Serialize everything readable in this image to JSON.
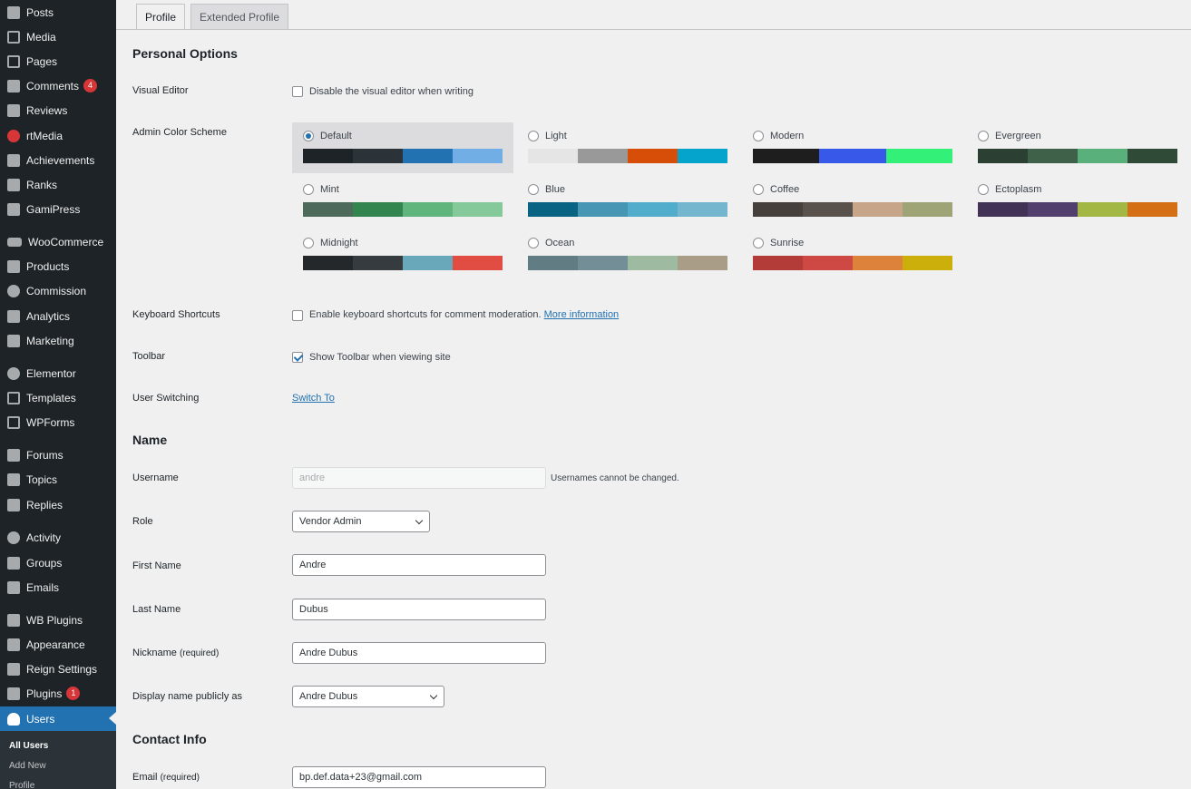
{
  "sidebar": {
    "items": [
      {
        "label": "Posts",
        "icon": "pin-icon"
      },
      {
        "label": "Media",
        "icon": "media-icon"
      },
      {
        "label": "Pages",
        "icon": "pages-icon"
      },
      {
        "label": "Comments",
        "icon": "comments-icon",
        "badge": "4"
      },
      {
        "label": "Reviews",
        "icon": "reviews-icon"
      },
      {
        "label": "rtMedia",
        "icon": "rtmedia-icon"
      },
      {
        "label": "Achievements",
        "icon": "achievements-icon"
      },
      {
        "label": "Ranks",
        "icon": "ranks-icon"
      },
      {
        "label": "GamiPress",
        "icon": "gamipress-icon"
      },
      {
        "label": "WooCommerce",
        "icon": "woocommerce-icon"
      },
      {
        "label": "Products",
        "icon": "products-icon"
      },
      {
        "label": "Commission",
        "icon": "commission-icon"
      },
      {
        "label": "Analytics",
        "icon": "analytics-icon"
      },
      {
        "label": "Marketing",
        "icon": "marketing-icon"
      },
      {
        "label": "Elementor",
        "icon": "elementor-icon"
      },
      {
        "label": "Templates",
        "icon": "templates-icon"
      },
      {
        "label": "WPForms",
        "icon": "wpforms-icon"
      },
      {
        "label": "Forums",
        "icon": "forums-icon"
      },
      {
        "label": "Topics",
        "icon": "topics-icon"
      },
      {
        "label": "Replies",
        "icon": "replies-icon"
      },
      {
        "label": "Activity",
        "icon": "activity-icon"
      },
      {
        "label": "Groups",
        "icon": "groups-icon"
      },
      {
        "label": "Emails",
        "icon": "emails-icon"
      },
      {
        "label": "WB Plugins",
        "icon": "wb-plugins-icon"
      },
      {
        "label": "Appearance",
        "icon": "appearance-icon"
      },
      {
        "label": "Reign Settings",
        "icon": "gear-icon"
      },
      {
        "label": "Plugins",
        "icon": "plugins-icon",
        "badge": "1"
      },
      {
        "label": "Users",
        "icon": "user-icon"
      }
    ],
    "submenu": [
      "All Users",
      "Add New",
      "Profile"
    ]
  },
  "tabs": [
    "Profile",
    "Extended Profile"
  ],
  "personal_options": {
    "title": "Personal Options",
    "visual_editor": {
      "label": "Visual Editor",
      "text": "Disable the visual editor when writing"
    },
    "color_scheme_label": "Admin Color Scheme",
    "schemes": [
      {
        "name": "Default",
        "colors": [
          "#1d2327",
          "#2c3338",
          "#2271b1",
          "#72aee6"
        ]
      },
      {
        "name": "Light",
        "colors": [
          "#e5e5e5",
          "#999999",
          "#d64e07",
          "#04a4cc"
        ]
      },
      {
        "name": "Modern",
        "colors": [
          "#1e1e1e",
          "#3858e9",
          "#33f078"
        ]
      },
      {
        "name": "Evergreen",
        "colors": [
          "#2b3f33",
          "#3f6049",
          "#5ab07a",
          "#2f4b37"
        ]
      },
      {
        "name": "Mint",
        "colors": [
          "#4e6a5a",
          "#33854f",
          "#5fb57c",
          "#85c99a"
        ]
      },
      {
        "name": "Blue",
        "colors": [
          "#096484",
          "#4796b3",
          "#52accc",
          "#74b6ce"
        ]
      },
      {
        "name": "Coffee",
        "colors": [
          "#46403c",
          "#59524c",
          "#c7a589",
          "#9ea476"
        ]
      },
      {
        "name": "Ectoplasm",
        "colors": [
          "#413256",
          "#523f6d",
          "#a3b745",
          "#d46f15"
        ]
      },
      {
        "name": "Midnight",
        "colors": [
          "#25282b",
          "#363b3f",
          "#69a8bb",
          "#e14d43"
        ]
      },
      {
        "name": "Ocean",
        "colors": [
          "#627c83",
          "#738e96",
          "#9ebaa0",
          "#aa9d88"
        ]
      },
      {
        "name": "Sunrise",
        "colors": [
          "#b43c38",
          "#cf4944",
          "#dd823b",
          "#ccaf0b"
        ]
      }
    ],
    "selected_scheme": "Default",
    "keyboard": {
      "label": "Keyboard Shortcuts",
      "text": "Enable keyboard shortcuts for comment moderation.",
      "link": "More information"
    },
    "toolbar": {
      "label": "Toolbar",
      "text": "Show Toolbar when viewing site"
    },
    "user_switching": {
      "label": "User Switching",
      "link": "Switch To"
    }
  },
  "name_section": {
    "title": "Name",
    "username": {
      "label": "Username",
      "value": "andre",
      "hint": "Usernames cannot be changed."
    },
    "role": {
      "label": "Role",
      "value": "Vendor Admin"
    },
    "first_name": {
      "label": "First Name",
      "value": "Andre"
    },
    "last_name": {
      "label": "Last Name",
      "value": "Dubus"
    },
    "nickname": {
      "label": "Nickname",
      "required": "(required)",
      "value": "Andre Dubus"
    },
    "display_name": {
      "label": "Display name publicly as",
      "value": "Andre Dubus"
    }
  },
  "contact": {
    "title": "Contact Info",
    "email": {
      "label": "Email",
      "required": "(required)",
      "value": "bp.def.data+23@gmail.com"
    }
  }
}
